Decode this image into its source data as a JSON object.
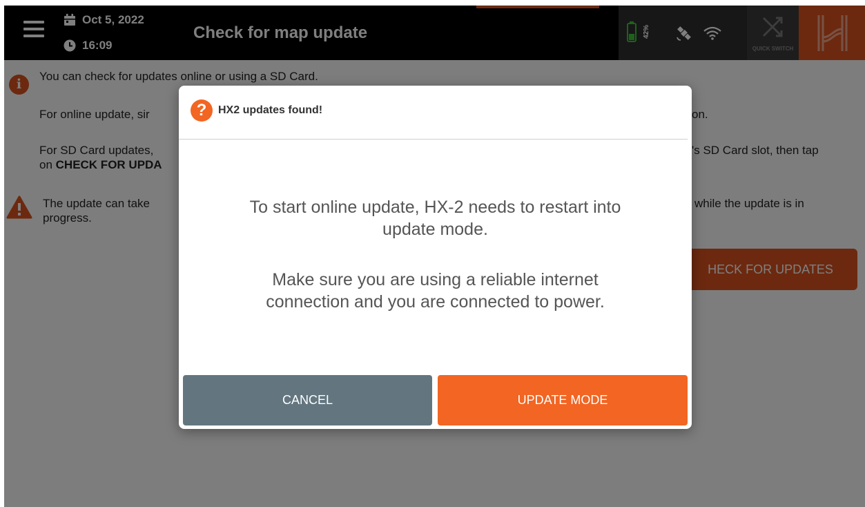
{
  "topbar": {
    "date": "Oct 5, 2022",
    "time": "16:09",
    "title": "Check for map update",
    "battery_pct": "42%",
    "quick_switch_label": "QUICK SWITCH"
  },
  "content": {
    "info_line1": "You can check for updates online or using a SD Card.",
    "online_line_start": "For online update, sir",
    "online_line_end": "on.",
    "sd_line1_start": "For SD Card updates,",
    "sd_line1_end": "'s SD Card slot, then tap",
    "sd_line2_start": "on ",
    "sd_line2_bold": "CHECK FOR UPDA",
    "warn_line1_start": "The update can take",
    "warn_line1_end": "while the update is in",
    "warn_line2": "progress.",
    "check_button": "HECK FOR UPDATES"
  },
  "dialog": {
    "title": "HX2 updates found!",
    "message1_line1": "To start online update, HX-2 needs to restart into",
    "message1_line2": "update mode.",
    "message2_line1": "Make sure you are using a reliable internet",
    "message2_line2": "connection and you are connected to power.",
    "cancel_label": "CANCEL",
    "update_label": "UPDATE MODE"
  },
  "colors": {
    "accent": "#d9531e",
    "dialog_accent": "#f26522",
    "cancel": "#637680",
    "battery": "#39c734"
  },
  "icons": [
    "menu-icon",
    "calendar-icon",
    "clock-icon",
    "battery-icon",
    "satellite-icon",
    "wifi-icon",
    "quick-switch-icon",
    "logo-icon",
    "info-icon",
    "warning-icon",
    "question-icon"
  ]
}
